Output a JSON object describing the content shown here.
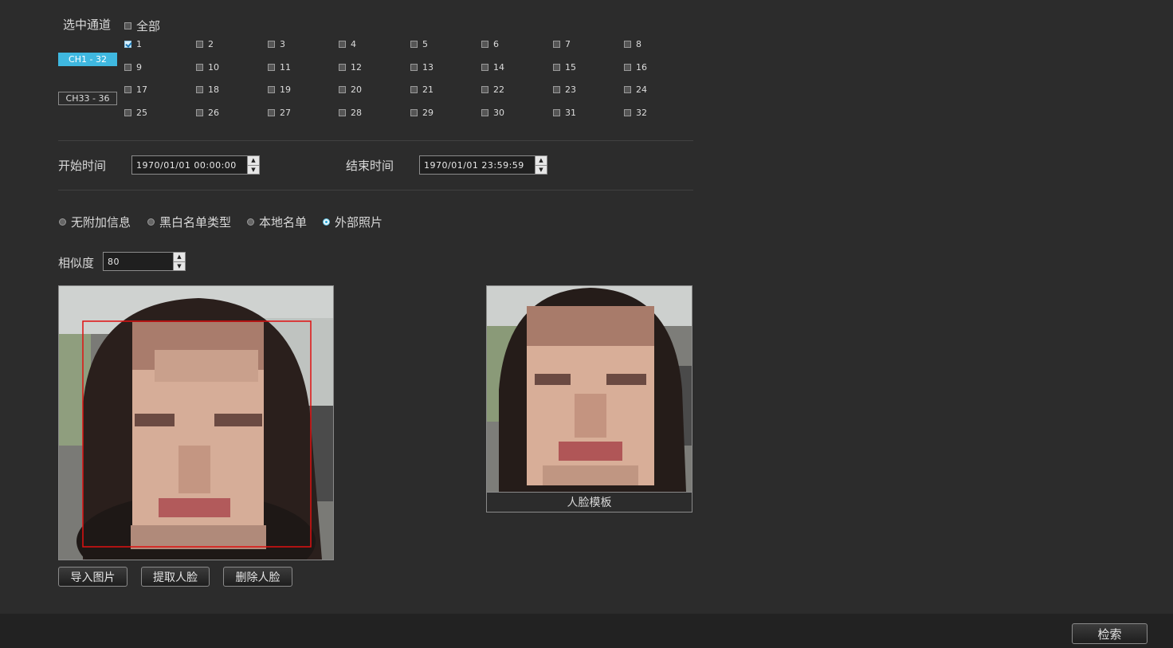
{
  "channels": {
    "title": "选中通道",
    "all_label": "全部",
    "tabs": [
      {
        "label": "CH1 - 32",
        "active": true
      },
      {
        "label": "CH33 - 36",
        "active": false
      }
    ],
    "items": [
      {
        "label": "1",
        "checked": true
      },
      {
        "label": "2",
        "checked": false
      },
      {
        "label": "3",
        "checked": false
      },
      {
        "label": "4",
        "checked": false
      },
      {
        "label": "5",
        "checked": false
      },
      {
        "label": "6",
        "checked": false
      },
      {
        "label": "7",
        "checked": false
      },
      {
        "label": "8",
        "checked": false
      },
      {
        "label": "9",
        "checked": false
      },
      {
        "label": "10",
        "checked": false
      },
      {
        "label": "11",
        "checked": false
      },
      {
        "label": "12",
        "checked": false
      },
      {
        "label": "13",
        "checked": false
      },
      {
        "label": "14",
        "checked": false
      },
      {
        "label": "15",
        "checked": false
      },
      {
        "label": "16",
        "checked": false
      },
      {
        "label": "17",
        "checked": false
      },
      {
        "label": "18",
        "checked": false
      },
      {
        "label": "19",
        "checked": false
      },
      {
        "label": "20",
        "checked": false
      },
      {
        "label": "21",
        "checked": false
      },
      {
        "label": "22",
        "checked": false
      },
      {
        "label": "23",
        "checked": false
      },
      {
        "label": "24",
        "checked": false
      },
      {
        "label": "25",
        "checked": false
      },
      {
        "label": "26",
        "checked": false
      },
      {
        "label": "27",
        "checked": false
      },
      {
        "label": "28",
        "checked": false
      },
      {
        "label": "29",
        "checked": false
      },
      {
        "label": "30",
        "checked": false
      },
      {
        "label": "31",
        "checked": false
      },
      {
        "label": "32",
        "checked": false
      }
    ]
  },
  "time": {
    "start_label": "开始时间",
    "start_value": "1970/01/01 00:00:00",
    "end_label": "结束时间",
    "end_value": "1970/01/01 23:59:59"
  },
  "options": [
    {
      "label": "无附加信息",
      "selected": false
    },
    {
      "label": "黑白名单类型",
      "selected": false
    },
    {
      "label": "本地名单",
      "selected": false
    },
    {
      "label": "外部照片",
      "selected": true
    }
  ],
  "similarity": {
    "label": "相似度",
    "value": "80"
  },
  "buttons": {
    "import": "导入图片",
    "extract": "提取人脸",
    "delete": "删除人脸",
    "search": "检索"
  },
  "template_caption": "人脸模板",
  "colors": {
    "accent": "#3fb8e0",
    "face_box": "#e01010"
  }
}
